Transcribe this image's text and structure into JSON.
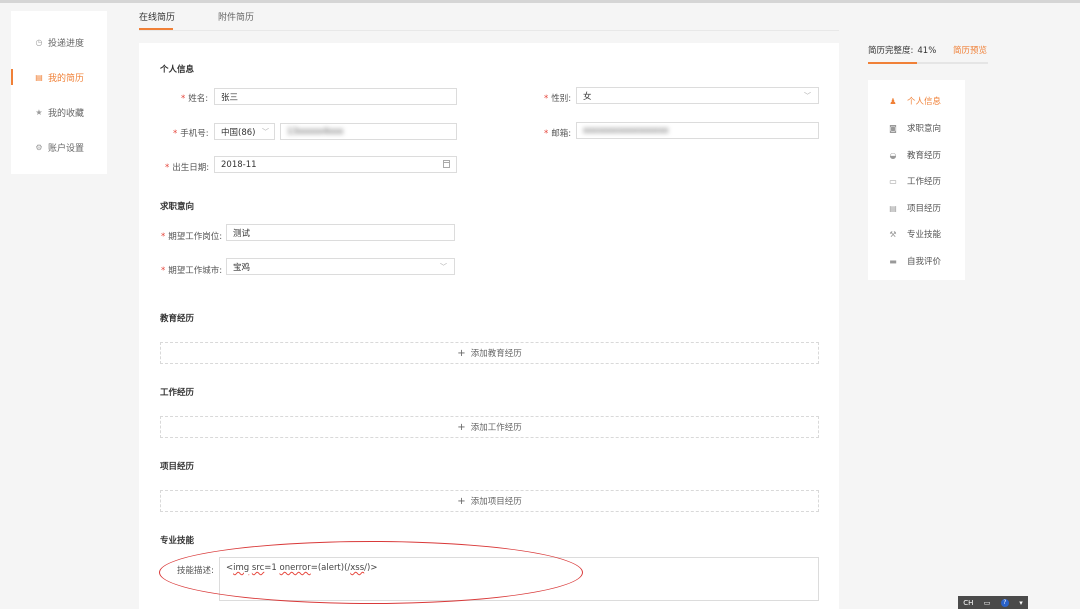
{
  "sidebar": {
    "items": [
      {
        "label": "投递进度",
        "icon": "clock-icon"
      },
      {
        "label": "我的简历",
        "icon": "resume-icon",
        "active": true
      },
      {
        "label": "我的收藏",
        "icon": "star-icon"
      },
      {
        "label": "账户设置",
        "icon": "settings-icon"
      }
    ]
  },
  "tabs": [
    {
      "label": "在线简历",
      "active": true
    },
    {
      "label": "附件简历"
    }
  ],
  "personal": {
    "title": "个人信息",
    "name_label": "姓名:",
    "name_value": "张三",
    "gender_label": "性别:",
    "gender_value": "女",
    "phone_label": "手机号:",
    "country_code": "中国(86)",
    "phone_value": "13xxxxx4xxx",
    "email_label": "邮箱:",
    "email_value": "xxxxxxxxxxxxxxxxx",
    "birth_label": "出生日期:",
    "birth_value": "2018-11"
  },
  "intent": {
    "title": "求职意向",
    "position_label": "期望工作岗位:",
    "position_value": "测试",
    "city_label": "期望工作城市:",
    "city_value": "宝鸡"
  },
  "education": {
    "title": "教育经历",
    "add_label": "添加教育经历"
  },
  "work": {
    "title": "工作经历",
    "add_label": "添加工作经历"
  },
  "project": {
    "title": "项目经历",
    "add_label": "添加项目经历"
  },
  "skills": {
    "title": "专业技能",
    "desc_label": "技能描述:",
    "desc_parts": [
      "<",
      "img",
      " ",
      "src",
      "=1 ",
      "onerror",
      "=(alert)(/",
      "xss",
      "/)>"
    ]
  },
  "right": {
    "completeness_label": "简历完整度:",
    "completeness_value": "41%",
    "completeness_fraction": 0.41,
    "preview_label": "简历预览",
    "nav": [
      {
        "label": "个人信息",
        "icon": "person-icon",
        "active": true
      },
      {
        "label": "求职意向",
        "icon": "briefcase-icon"
      },
      {
        "label": "教育经历",
        "icon": "graduation-cap-icon"
      },
      {
        "label": "工作经历",
        "icon": "bag-icon"
      },
      {
        "label": "项目经历",
        "icon": "document-icon"
      },
      {
        "label": "专业技能",
        "icon": "wrench-icon"
      },
      {
        "label": "自我评价",
        "icon": "comment-icon"
      }
    ]
  },
  "taskbar": {
    "ime": "CH",
    "help": "?"
  },
  "colors": {
    "accent": "#f08037",
    "required": "#e6463c",
    "annotation": "#d93a3a"
  }
}
